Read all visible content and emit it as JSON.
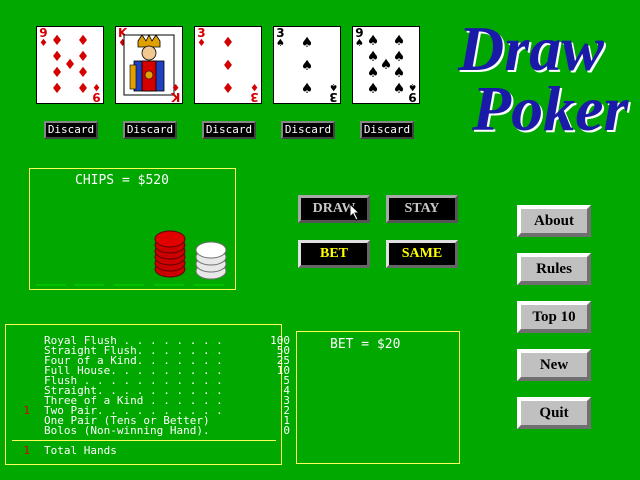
{
  "title": {
    "line1": "Draw",
    "line2": "Poker"
  },
  "cards": [
    {
      "rank": "9",
      "suit": "diamond",
      "color": "red"
    },
    {
      "rank": "K",
      "suit": "diamond",
      "color": "red"
    },
    {
      "rank": "3",
      "suit": "diamond",
      "color": "red"
    },
    {
      "rank": "3",
      "suit": "spade",
      "color": "black"
    },
    {
      "rank": "9",
      "suit": "spade",
      "color": "black"
    }
  ],
  "discard_label": "Discard",
  "chips": {
    "label": "CHIPS = $520",
    "stacks": [
      {
        "color": "red",
        "count": 6
      },
      {
        "color": "white",
        "count": 4
      }
    ]
  },
  "buttons": {
    "draw": "DRAW",
    "stay": "STAY",
    "bet": "BET",
    "same": "SAME"
  },
  "side_buttons": {
    "about": "About",
    "rules": "Rules",
    "top10": "Top 10",
    "new": "New",
    "quit": "Quit"
  },
  "bet": {
    "label": "BET = $20"
  },
  "payouts": [
    {
      "count": "",
      "name": "Royal Flush . . . . . . . .",
      "mult": "100"
    },
    {
      "count": "",
      "name": "Straight Flush. . . . . . .",
      "mult": "50"
    },
    {
      "count": "",
      "name": "Four of a Kind. . . . . . .",
      "mult": "25"
    },
    {
      "count": "",
      "name": "Full House. . . . . . . . .",
      "mult": "10"
    },
    {
      "count": "",
      "name": "Flush . . . . . . . . . . .",
      "mult": "5"
    },
    {
      "count": "",
      "name": "Straight. . . . . . . . . .",
      "mult": "4"
    },
    {
      "count": "",
      "name": "Three of a Kind . . . . . .",
      "mult": "3"
    },
    {
      "count": "1",
      "name": "Two Pair. . . . . . . . . .",
      "mult": "2"
    },
    {
      "count": "",
      "name": "One Pair (Tens or Better)",
      "mult": "1"
    },
    {
      "count": "",
      "name": "Bolos (Non-winning Hand).",
      "mult": "0"
    }
  ],
  "total": {
    "count": "1",
    "label": "Total Hands"
  },
  "colors": {
    "felt": "#00a800",
    "title": "#1a1aa8",
    "panel_border": "#ffff55",
    "chip_red": "#cc0000"
  }
}
